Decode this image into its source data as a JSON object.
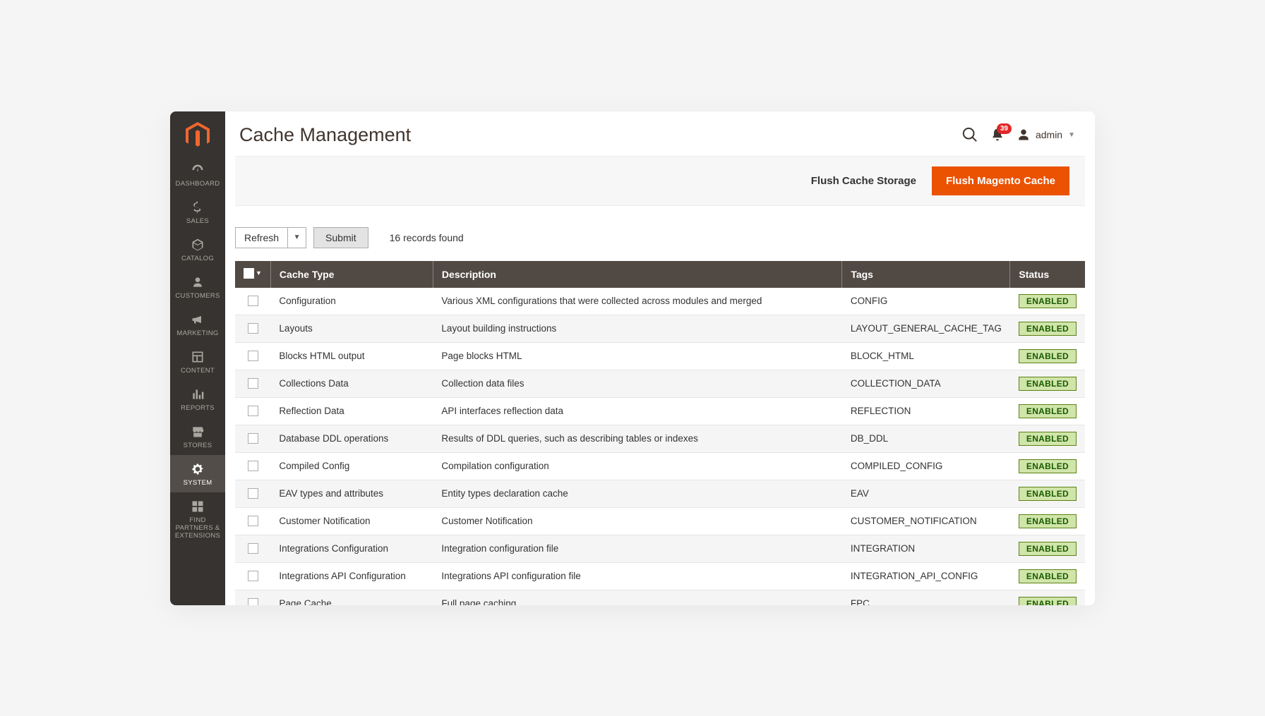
{
  "header": {
    "title": "Cache Management",
    "notif_count": "39",
    "username": "admin"
  },
  "sidebar": {
    "items": [
      {
        "label": "DASHBOARD",
        "icon": "gauge"
      },
      {
        "label": "SALES",
        "icon": "dollar"
      },
      {
        "label": "CATALOG",
        "icon": "box"
      },
      {
        "label": "CUSTOMERS",
        "icon": "person"
      },
      {
        "label": "MARKETING",
        "icon": "megaphone"
      },
      {
        "label": "CONTENT",
        "icon": "layout"
      },
      {
        "label": "REPORTS",
        "icon": "bars"
      },
      {
        "label": "STORES",
        "icon": "storefront"
      },
      {
        "label": "SYSTEM",
        "icon": "gear",
        "active": true
      },
      {
        "label": "FIND PARTNERS & EXTENSIONS",
        "icon": "blocks"
      }
    ]
  },
  "actions": {
    "flush_storage": "Flush Cache Storage",
    "flush_magento": "Flush Magento Cache"
  },
  "toolbar": {
    "select_label": "Refresh",
    "submit_label": "Submit",
    "records_text": "16 records found"
  },
  "table": {
    "headers": {
      "type": "Cache Type",
      "description": "Description",
      "tags": "Tags",
      "status": "Status"
    },
    "rows": [
      {
        "type": "Configuration",
        "description": "Various XML configurations that were collected across modules and merged",
        "tags": "CONFIG",
        "status": "ENABLED"
      },
      {
        "type": "Layouts",
        "description": "Layout building instructions",
        "tags": "LAYOUT_GENERAL_CACHE_TAG",
        "status": "ENABLED"
      },
      {
        "type": "Blocks HTML output",
        "description": "Page blocks HTML",
        "tags": "BLOCK_HTML",
        "status": "ENABLED"
      },
      {
        "type": "Collections Data",
        "description": "Collection data files",
        "tags": "COLLECTION_DATA",
        "status": "ENABLED"
      },
      {
        "type": "Reflection Data",
        "description": "API interfaces reflection data",
        "tags": "REFLECTION",
        "status": "ENABLED"
      },
      {
        "type": "Database DDL operations",
        "description": "Results of DDL queries, such as describing tables or indexes",
        "tags": "DB_DDL",
        "status": "ENABLED"
      },
      {
        "type": "Compiled Config",
        "description": "Compilation configuration",
        "tags": "COMPILED_CONFIG",
        "status": "ENABLED"
      },
      {
        "type": "EAV types and attributes",
        "description": "Entity types declaration cache",
        "tags": "EAV",
        "status": "ENABLED"
      },
      {
        "type": "Customer Notification",
        "description": "Customer Notification",
        "tags": "CUSTOMER_NOTIFICATION",
        "status": "ENABLED"
      },
      {
        "type": "Integrations Configuration",
        "description": "Integration configuration file",
        "tags": "INTEGRATION",
        "status": "ENABLED"
      },
      {
        "type": "Integrations API Configuration",
        "description": "Integrations API configuration file",
        "tags": "INTEGRATION_API_CONFIG",
        "status": "ENABLED"
      },
      {
        "type": "Page Cache",
        "description": "Full page caching",
        "tags": "FPC",
        "status": "ENABLED"
      }
    ]
  }
}
